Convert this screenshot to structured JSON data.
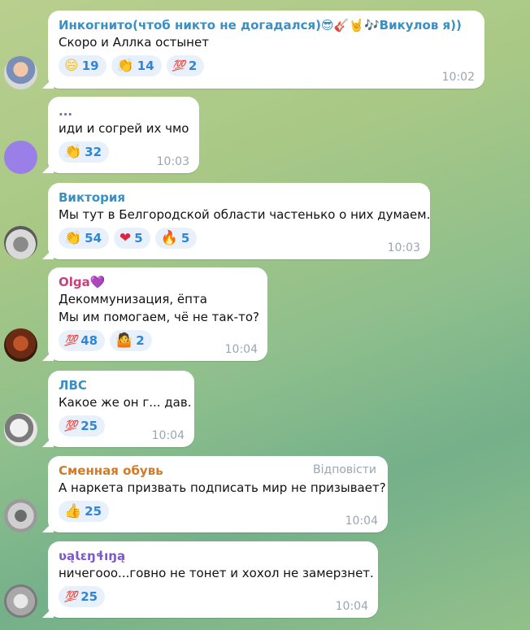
{
  "colors": {
    "accent_blue": "#2f86d6",
    "reaction_bg": "#e8f1fb",
    "time_gray": "#9aa6b0"
  },
  "messages": [
    {
      "sender": "Инкогнито(чтоб никто не догадался)😎🎸🤘🎶Викулов я))",
      "sender_color": "#3a8fc4",
      "lines": [
        "Скоро и Аллка остынет"
      ],
      "reactions": [
        {
          "emoji": "😄",
          "icon": "grin-emoji-icon",
          "count": "19"
        },
        {
          "emoji": "👏",
          "icon": "clap-emoji-icon",
          "count": "14"
        },
        {
          "emoji": "💯",
          "icon": "hundred-emoji-icon",
          "count": "2"
        }
      ],
      "time": "10:02"
    },
    {
      "sender": "...",
      "sender_color": "#7b59c9",
      "lines": [
        "иди и согрей их чмо"
      ],
      "reactions": [
        {
          "emoji": "👏",
          "icon": "clap-emoji-icon",
          "count": "32"
        }
      ],
      "time": "10:03"
    },
    {
      "sender": "Виктория",
      "sender_color": "#3a8fc4",
      "lines": [
        "Мы тут в Белгородской области частенько о них думаем."
      ],
      "reactions": [
        {
          "emoji": "👏",
          "icon": "clap-emoji-icon",
          "count": "54"
        },
        {
          "emoji": "❤",
          "icon": "heart-emoji-icon",
          "count": "5"
        },
        {
          "emoji": "🔥",
          "icon": "fire-emoji-icon",
          "count": "5"
        }
      ],
      "time": "10:03"
    },
    {
      "sender": "Olga💜",
      "sender_color": "#cc3f7a",
      "lines": [
        "Декоммунизация, ёпта",
        "Мы им помогаем, чё не так-то?"
      ],
      "reactions": [
        {
          "emoji": "💯",
          "icon": "hundred-emoji-icon",
          "count": "48"
        },
        {
          "emoji": "🤷",
          "icon": "shrug-emoji-icon",
          "count": "2"
        }
      ],
      "time": "10:04"
    },
    {
      "sender": "ЛВС",
      "sender_color": "#3a8fc4",
      "lines": [
        "Какое же он г... дав."
      ],
      "reactions": [
        {
          "emoji": "💯",
          "icon": "hundred-emoji-icon",
          "count": "25"
        }
      ],
      "time": "10:04"
    },
    {
      "sender": "Сменная обувь",
      "sender_color": "#d07a2a",
      "reply_label": "Відповісти",
      "lines": [
        "А наркета призвать подписать мир не призывает?"
      ],
      "reactions": [
        {
          "emoji": "👍",
          "icon": "thumbs-up-emoji-icon",
          "count": "25"
        }
      ],
      "time": "10:04"
    },
    {
      "sender": "ʋąƖɛŋɬıŋą",
      "sender_color": "#7b59c9",
      "lines": [
        "ничегооо...говно не тонет и хохол не замерзнет."
      ],
      "reactions": [
        {
          "emoji": "💯",
          "icon": "hundred-emoji-icon",
          "count": "25"
        }
      ],
      "time": "10:04"
    }
  ]
}
